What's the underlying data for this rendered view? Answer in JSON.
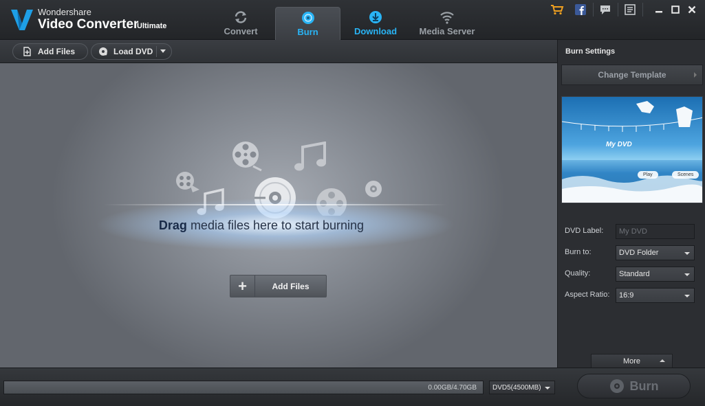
{
  "app": {
    "brand_top": "Wondershare",
    "brand_main": "Video Converter",
    "brand_edition": "Ultimate"
  },
  "tabs": [
    {
      "label": "Convert",
      "active": false
    },
    {
      "label": "Burn",
      "active": true
    },
    {
      "label": "Download",
      "active": false
    },
    {
      "label": "Media Server",
      "active": false
    }
  ],
  "title_icons": [
    "cart-icon",
    "facebook-icon",
    "chat-icon",
    "menu-icon",
    "minimize-icon",
    "maximize-icon",
    "close-icon"
  ],
  "toolbar": {
    "add_files_label": "Add Files",
    "load_dvd_label": "Load DVD"
  },
  "droparea": {
    "drag_bold": "Drag",
    "drag_rest": " media files here to start burning",
    "add_files_label": "Add Files"
  },
  "burn_settings": {
    "title": "Burn Settings",
    "change_template_label": "Change Template",
    "preview": {
      "title": "My DVD",
      "play_label": "Play",
      "scenes_label": "Scenes"
    },
    "fields": {
      "dvd_label": {
        "label": "DVD Label:",
        "placeholder": "My DVD"
      },
      "burn_to": {
        "label": "Burn to:",
        "value": "DVD Folder"
      },
      "quality": {
        "label": "Quality:",
        "value": "Standard"
      },
      "aspect_ratio": {
        "label": "Aspect Ratio:",
        "value": "16:9"
      }
    },
    "more_label": "More"
  },
  "statusbar": {
    "capacity_text": "0.00GB/4.70GB",
    "capacity_fraction": 0.0,
    "disc_type": "DVD5(4500MB)",
    "burn_label": "Burn"
  },
  "colors": {
    "accent_blue": "#29b4f5",
    "panel_dark": "#2c2e32",
    "droparea_light": "#a6abb3"
  }
}
